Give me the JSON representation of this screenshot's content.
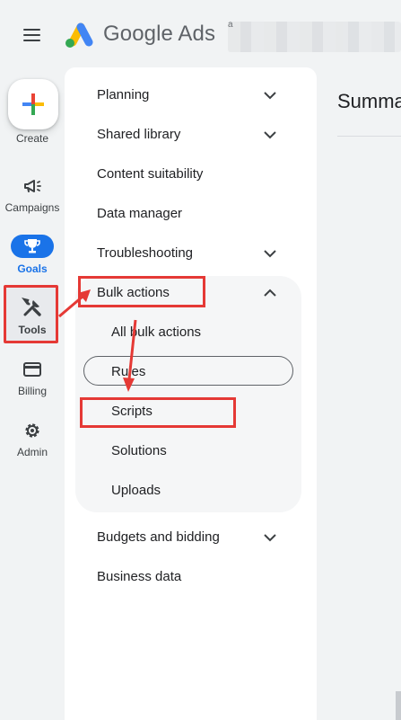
{
  "header": {
    "app_name": "Google Ads",
    "account_fragment": "a"
  },
  "rail": {
    "create_label": "Create",
    "items": [
      {
        "label": "Campaigns",
        "icon": "megaphone-icon"
      },
      {
        "label": "Goals",
        "icon": "trophy-icon"
      },
      {
        "label": "Tools",
        "icon": "tools-icon"
      },
      {
        "label": "Billing",
        "icon": "credit-card-icon"
      },
      {
        "label": "Admin",
        "icon": "gear-icon"
      }
    ]
  },
  "menu": {
    "items": [
      {
        "label": "Planning",
        "expandable": true
      },
      {
        "label": "Shared library",
        "expandable": true
      },
      {
        "label": "Content suitability",
        "expandable": false
      },
      {
        "label": "Data manager",
        "expandable": false
      },
      {
        "label": "Troubleshooting",
        "expandable": true
      },
      {
        "label": "Bulk actions",
        "expandable": true,
        "expanded": true
      },
      {
        "label": "Budgets and bidding",
        "expandable": true
      },
      {
        "label": "Business data",
        "expandable": false
      }
    ],
    "bulk_actions_sub": [
      {
        "label": "All bulk actions"
      },
      {
        "label": "Rules",
        "hovered": true
      },
      {
        "label": "Scripts",
        "annotated": true
      },
      {
        "label": "Solutions"
      },
      {
        "label": "Uploads"
      }
    ]
  },
  "main": {
    "title": "Summa"
  },
  "colors": {
    "accent": "#1a73e8",
    "annotation": "#e53935",
    "background": "#f1f3f4"
  }
}
